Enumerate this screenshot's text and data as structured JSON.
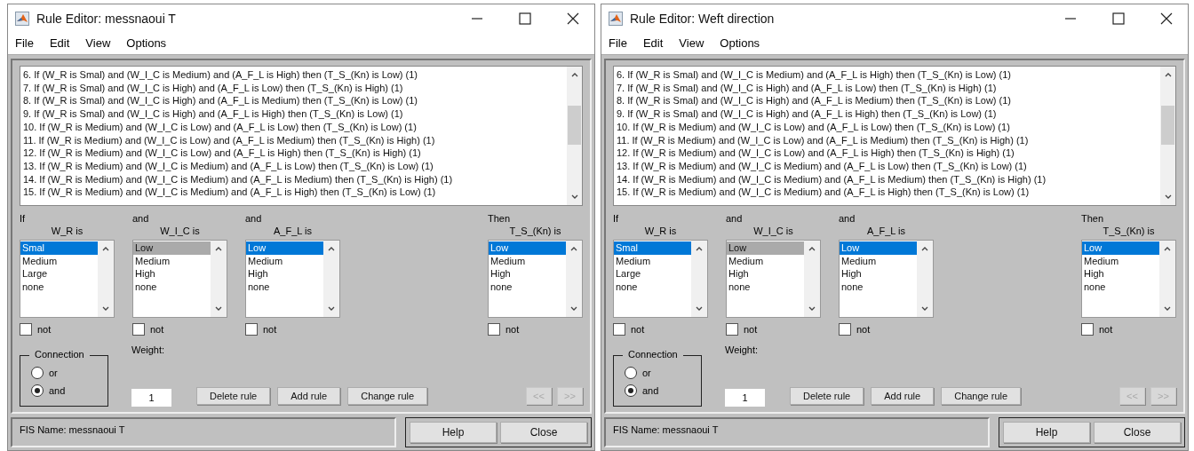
{
  "windows": [
    {
      "title": "Rule Editor: messnaoui T",
      "menus": [
        "File",
        "Edit",
        "View",
        "Options"
      ],
      "rules": [
        "6. If (W_R is Smal) and (W_I_C is Medium) and (A_F_L is High) then (T_S_(Kn) is Low) (1)",
        "7. If (W_R is Smal) and (W_I_C is High) and (A_F_L is Low) then (T_S_(Kn) is High) (1)",
        "8. If (W_R is Smal) and (W_I_C is High) and (A_F_L is Medium) then (T_S_(Kn) is Low) (1)",
        "9. If (W_R is Smal) and (W_I_C is High) and (A_F_L is High) then (T_S_(Kn) is Low) (1)",
        "10. If (W_R is Medium) and (W_I_C is Low) and (A_F_L is Low) then (T_S_(Kn) is Low) (1)",
        "11. If (W_R is Medium) and (W_I_C is Low) and (A_F_L is Medium) then (T_S_(Kn) is High) (1)",
        "12. If (W_R is Medium) and (W_I_C is Low) and (A_F_L is High) then (T_S_(Kn) is High) (1)",
        "13. If (W_R is Medium) and (W_I_C is Medium) and (A_F_L is Low) then (T_S_(Kn) is Low) (1)",
        "14. If (W_R is Medium) and (W_I_C is Medium) and (A_F_L is Medium) then (T_S_(Kn) is High) (1)",
        "15. If (W_R is Medium) and (W_I_C is Medium) and (A_F_L is High) then (T_S_(Kn) is Low) (1)"
      ],
      "columns": [
        {
          "header": "If",
          "label": "W_R is",
          "focused": true,
          "options": [
            {
              "label": "Smal",
              "selected": true
            },
            {
              "label": "Medium",
              "selected": false
            },
            {
              "label": "Large",
              "selected": false
            },
            {
              "label": "none",
              "selected": false
            }
          ],
          "not": {
            "label": "not",
            "checked": false
          }
        },
        {
          "header": "and",
          "label": "W_I_C is",
          "focused": false,
          "options": [
            {
              "label": "Low",
              "selected": true
            },
            {
              "label": "Medium",
              "selected": false
            },
            {
              "label": "High",
              "selected": false
            },
            {
              "label": "none",
              "selected": false
            }
          ],
          "not": {
            "label": "not",
            "checked": false
          }
        },
        {
          "header": "and",
          "label": "A_F_L is",
          "focused": true,
          "options": [
            {
              "label": "Low",
              "selected": true
            },
            {
              "label": "Medium",
              "selected": false
            },
            {
              "label": "High",
              "selected": false
            },
            {
              "label": "none",
              "selected": false
            }
          ],
          "not": {
            "label": "not",
            "checked": false
          }
        },
        {
          "header": "Then",
          "label": "T_S_(Kn) is",
          "focused": true,
          "options": [
            {
              "label": "Low",
              "selected": true
            },
            {
              "label": "Medium",
              "selected": false
            },
            {
              "label": "High",
              "selected": false
            },
            {
              "label": "none",
              "selected": false
            }
          ],
          "not": {
            "label": "not",
            "checked": false
          }
        }
      ],
      "connection": {
        "label": "Connection",
        "options": [
          {
            "label": "or",
            "selected": false
          },
          {
            "label": "and",
            "selected": true
          }
        ]
      },
      "weight": {
        "label": "Weight:",
        "value": "1"
      },
      "actions": [
        {
          "label": "Delete rule",
          "disabled": false
        },
        {
          "label": "Add rule",
          "disabled": false
        },
        {
          "label": "Change rule",
          "disabled": false
        }
      ],
      "nav": [
        {
          "label": "<<",
          "disabled": true
        },
        {
          "label": ">>",
          "disabled": true
        }
      ],
      "fis_name": "FIS Name: messnaoui T",
      "footer_buttons": [
        "Help",
        "Close"
      ]
    },
    {
      "title": "Rule Editor: Weft direction",
      "menus": [
        "File",
        "Edit",
        "View",
        "Options"
      ],
      "rules": [
        "6. If (W_R is Smal) and (W_I_C is Medium) and (A_F_L is High) then (T_S_(Kn) is Low) (1)",
        "7. If (W_R is Smal) and (W_I_C is High) and (A_F_L is Low) then (T_S_(Kn) is High) (1)",
        "8. If (W_R is Smal) and (W_I_C is High) and (A_F_L is Medium) then (T_S_(Kn) is Low) (1)",
        "9. If (W_R is Smal) and (W_I_C is High) and (A_F_L is High) then (T_S_(Kn) is Low) (1)",
        "10. If (W_R is Medium) and (W_I_C is Low) and (A_F_L is Low) then (T_S_(Kn) is Low) (1)",
        "11. If (W_R is Medium) and (W_I_C is Low) and (A_F_L is Medium) then (T_S_(Kn) is High) (1)",
        "12. If (W_R is Medium) and (W_I_C is Low) and (A_F_L is High) then (T_S_(Kn) is High) (1)",
        "13. If (W_R is Medium) and (W_I_C is Medium) and (A_F_L is Low) then (T_S_(Kn) is Low) (1)",
        "14. If (W_R is Medium) and (W_I_C is Medium) and (A_F_L is Medium) then (T_S_(Kn) is High) (1)",
        "15. If (W_R is Medium) and (W_I_C is Medium) and (A_F_L is High) then (T_S_(Kn) is Low) (1)"
      ],
      "columns": [
        {
          "header": "If",
          "label": "W_R is",
          "focused": true,
          "options": [
            {
              "label": "Smal",
              "selected": true
            },
            {
              "label": "Medium",
              "selected": false
            },
            {
              "label": "Large",
              "selected": false
            },
            {
              "label": "none",
              "selected": false
            }
          ],
          "not": {
            "label": "not",
            "checked": false
          }
        },
        {
          "header": "and",
          "label": "W_I_C is",
          "focused": false,
          "options": [
            {
              "label": "Low",
              "selected": true
            },
            {
              "label": "Medium",
              "selected": false
            },
            {
              "label": "High",
              "selected": false
            },
            {
              "label": "none",
              "selected": false
            }
          ],
          "not": {
            "label": "not",
            "checked": false
          }
        },
        {
          "header": "and",
          "label": "A_F_L is",
          "focused": true,
          "options": [
            {
              "label": "Low",
              "selected": true
            },
            {
              "label": "Medium",
              "selected": false
            },
            {
              "label": "High",
              "selected": false
            },
            {
              "label": "none",
              "selected": false
            }
          ],
          "not": {
            "label": "not",
            "checked": false
          }
        },
        {
          "header": "Then",
          "label": "T_S_(Kn) is",
          "focused": true,
          "options": [
            {
              "label": "Low",
              "selected": true
            },
            {
              "label": "Medium",
              "selected": false
            },
            {
              "label": "High",
              "selected": false
            },
            {
              "label": "none",
              "selected": false
            }
          ],
          "not": {
            "label": "not",
            "checked": false
          }
        }
      ],
      "connection": {
        "label": "Connection",
        "options": [
          {
            "label": "or",
            "selected": false
          },
          {
            "label": "and",
            "selected": true
          }
        ]
      },
      "weight": {
        "label": "Weight:",
        "value": "1"
      },
      "actions": [
        {
          "label": "Delete rule",
          "disabled": false
        },
        {
          "label": "Add rule",
          "disabled": false
        },
        {
          "label": "Change rule",
          "disabled": false
        }
      ],
      "nav": [
        {
          "label": "<<",
          "disabled": true
        },
        {
          "label": ">>",
          "disabled": true
        }
      ],
      "fis_name": "FIS Name: messnaoui T",
      "footer_buttons": [
        "Help",
        "Close"
      ]
    }
  ]
}
